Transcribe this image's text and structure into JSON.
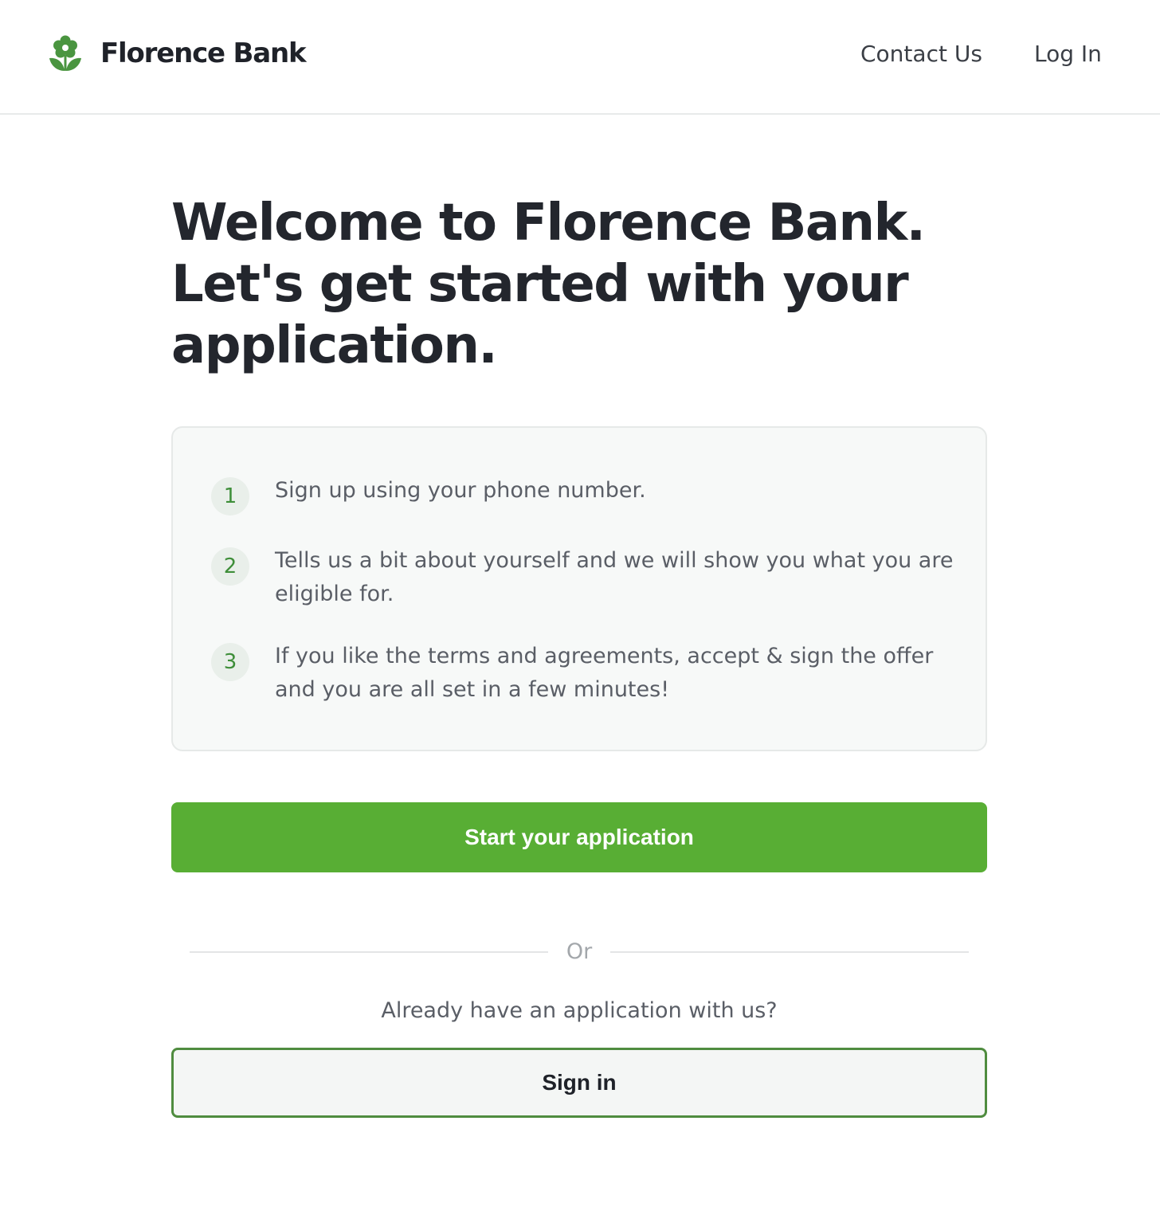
{
  "header": {
    "brand_name": "Florence Bank",
    "brand_icon": "flower-icon",
    "nav": {
      "contact_label": "Contact Us",
      "login_label": "Log In"
    }
  },
  "main": {
    "headline_lines": [
      "Welcome to Florence Bank.",
      "Let's get started with your",
      "application."
    ],
    "steps": [
      {
        "number": "1",
        "text": "Sign up using your phone number."
      },
      {
        "number": "2",
        "text": "Tells us a bit about yourself and we will show you what you are eligible for."
      },
      {
        "number": "3",
        "text": "If you like the terms and agreements, accept & sign the offer and you are all set in a few minutes!"
      }
    ],
    "primary_button_label": "Start your application",
    "divider_label": "Or",
    "existing_prompt": "Already have an application with us?",
    "secondary_button_label": "Sign in"
  },
  "colors": {
    "brand_green": "#58ae34",
    "icon_green": "#4a9540",
    "outline_green": "#4f8c3f",
    "heading_text": "#23262d",
    "body_text": "#5a5e66"
  }
}
